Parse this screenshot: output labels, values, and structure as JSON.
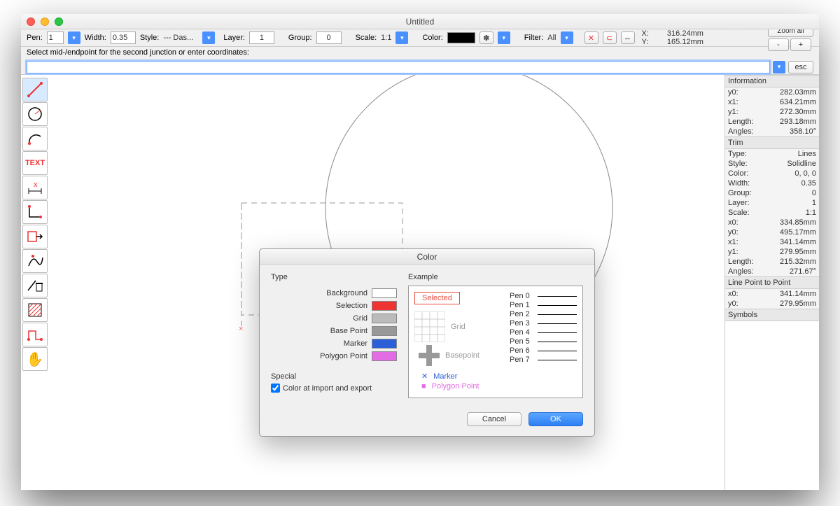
{
  "window": {
    "title": "Untitled"
  },
  "toolbar": {
    "pen_label": "Pen:",
    "pen_value": "1",
    "width_label": "Width:",
    "width_value": "0.35",
    "style_label": "Style:",
    "style_value": "--- Das...",
    "layer_label": "Layer:",
    "layer_value": "1",
    "group_label": "Group:",
    "group_value": "0",
    "scale_label": "Scale:",
    "scale_value": "1:1",
    "color_label": "Color:",
    "filter_label": "Filter:",
    "filter_value": "All",
    "x_label": "X:",
    "x_value": "316.24mm",
    "y_label": "Y:",
    "y_value": "165.12mm",
    "zoomall": "Zoom all",
    "minus": "-",
    "plus": "+",
    "esc": "esc"
  },
  "prompt": "Select mid-/endpoint for the second junction or enter coordinates:",
  "info": {
    "header": "Information",
    "y0": "282.03mm",
    "x1": "634.21mm",
    "y1": "272.30mm",
    "length": "293.18mm",
    "angles": "358.10°"
  },
  "trim": {
    "header": "Trim",
    "type_l": "Type:",
    "type_v": "Lines",
    "style_l": "Style:",
    "style_v": "Solidline",
    "color_l": "Color:",
    "color_v": "0, 0, 0",
    "width_l": "Width:",
    "width_v": "0.35",
    "group_l": "Group:",
    "group_v": "0",
    "layer_l": "Layer:",
    "layer_v": "1",
    "scale_l": "Scale:",
    "scale_v": "1:1",
    "x0_l": "x0:",
    "x0_v": "334.85mm",
    "y0_l": "y0:",
    "y0_v": "495.17mm",
    "x1_l": "x1:",
    "x1_v": "341.14mm",
    "y1_l": "y1:",
    "y1_v": "279.95mm",
    "len_l": "Length:",
    "len_v": "215.32mm",
    "ang_l": "Angles:",
    "ang_v": "271.67°"
  },
  "lpp": {
    "header": "Line Point to Point",
    "x0_l": "x0:",
    "x0_v": "341.14mm",
    "y0_l": "y0:",
    "y0_v": "279.95mm"
  },
  "symbols": {
    "header": "Symbols"
  },
  "dialog": {
    "title": "Color",
    "type": "Type",
    "background": "Background",
    "selection": "Selection",
    "grid": "Grid",
    "basepoint": "Base Point",
    "marker": "Marker",
    "polypoint": "Polygon Point",
    "special": "Special",
    "importexport": "Color at import and export",
    "example": "Example",
    "selected": "Selected",
    "gridlbl": "Grid",
    "bplbl": "Basepoint",
    "markerlbl": "Marker",
    "pplbl": "Polygon Point",
    "pens": [
      "Pen 0",
      "Pen 1",
      "Pen 2",
      "Pen 3",
      "Pen 4",
      "Pen 5",
      "Pen 6",
      "Pen 7"
    ],
    "cancel": "Cancel",
    "ok": "OK"
  },
  "tools": {
    "text": "TEXT"
  }
}
